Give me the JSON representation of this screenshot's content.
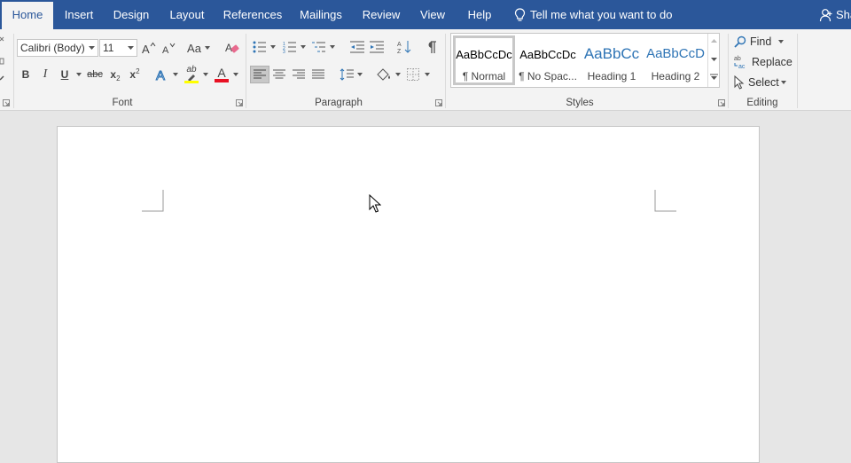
{
  "tabs": [
    {
      "label": "Home",
      "active": true
    },
    {
      "label": "Insert"
    },
    {
      "label": "Design"
    },
    {
      "label": "Layout"
    },
    {
      "label": "References"
    },
    {
      "label": "Mailings"
    },
    {
      "label": "Review"
    },
    {
      "label": "View"
    },
    {
      "label": "Help"
    }
  ],
  "tell_me": "Tell me what you want to do",
  "share_label": "Sha",
  "font": {
    "group_label": "Font",
    "family": "Calibri (Body)",
    "size": "11",
    "change_case": "Aa",
    "bold": "B",
    "italic": "I",
    "underline": "U",
    "strikethrough": "abc",
    "subscript": "x",
    "superscript": "x",
    "highlight_text": "ab",
    "font_color_text": "A",
    "highlight_color": "#ffff00",
    "font_color": "#e81123"
  },
  "paragraph": {
    "group_label": "Paragraph"
  },
  "styles": {
    "group_label": "Styles",
    "items": [
      {
        "preview": "AaBbCcDc",
        "name": "¶ Normal",
        "selected": true
      },
      {
        "preview": "AaBbCcDc",
        "name": "¶ No Spac..."
      },
      {
        "preview": "AaBbCc",
        "name": "Heading 1"
      },
      {
        "preview": "AaBbCcD",
        "name": "Heading 2"
      }
    ],
    "heading_color": "#2e74b5"
  },
  "editing": {
    "group_label": "Editing",
    "find": "Find",
    "replace": "Replace",
    "select": "Select"
  },
  "colors": {
    "accent": "#2b579a",
    "ribbon_bg": "#f3f3f3",
    "canvas_bg": "#e6e6e6"
  }
}
